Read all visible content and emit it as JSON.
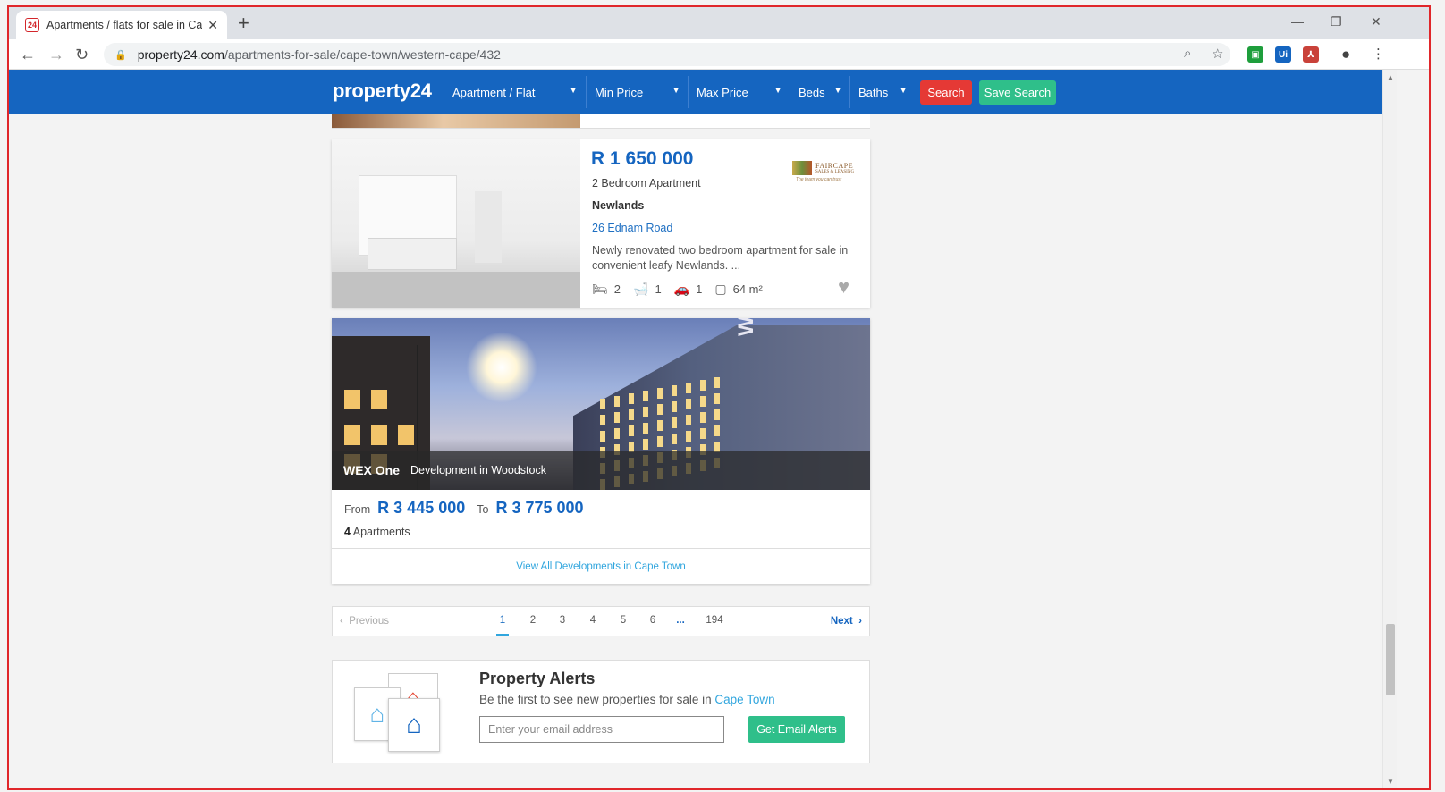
{
  "browser": {
    "tab_title": "Apartments / flats for sale in Cap",
    "tab_favicon": "24",
    "url_host": "property24.com",
    "url_path": "/apartments-for-sale/cape-town/western-cape/432"
  },
  "header": {
    "logo": "property24",
    "filters": {
      "type": "Apartment / Flat",
      "min_price": "Min Price",
      "max_price": "Max Price",
      "beds": "Beds",
      "baths": "Baths"
    },
    "search_label": "Search",
    "save_search_label": "Save Search",
    "colors": {
      "bar": "#1565c0",
      "search": "#e53935",
      "save": "#2fbf8a"
    }
  },
  "listing": {
    "price": "R 1 650 000",
    "type": "2 Bedroom Apartment",
    "suburb": "Newlands",
    "street": "26 Ednam Road",
    "description": "Newly renovated two bedroom apartment for sale in convenient leafy Newlands. ...",
    "agency_name": "FAIRCAPE",
    "agency_sub": "SALES & LEASING",
    "agency_tag": "The team you can trust",
    "bedrooms": "2",
    "bathrooms": "1",
    "parking": "1",
    "size": "64 m²"
  },
  "development": {
    "image_brand": "WEX",
    "name": "WEX One",
    "location": "Development in Woodstock",
    "from_label": "From",
    "price_from": "R 3 445 000",
    "to_label": "To",
    "price_to": "R 3 775 000",
    "unit_count": "4",
    "unit_label": "Apartments",
    "view_all": "View All Developments in Cape Town"
  },
  "pagination": {
    "previous": "Previous",
    "next": "Next",
    "pages": [
      "1",
      "2",
      "3",
      "4",
      "5",
      "6",
      "...",
      "194"
    ],
    "current": "1"
  },
  "alerts": {
    "title": "Property Alerts",
    "subtitle_prefix": "Be the first to see new properties for sale in ",
    "city": "Cape Town",
    "email_placeholder": "Enter your email address",
    "button": "Get Email Alerts"
  }
}
